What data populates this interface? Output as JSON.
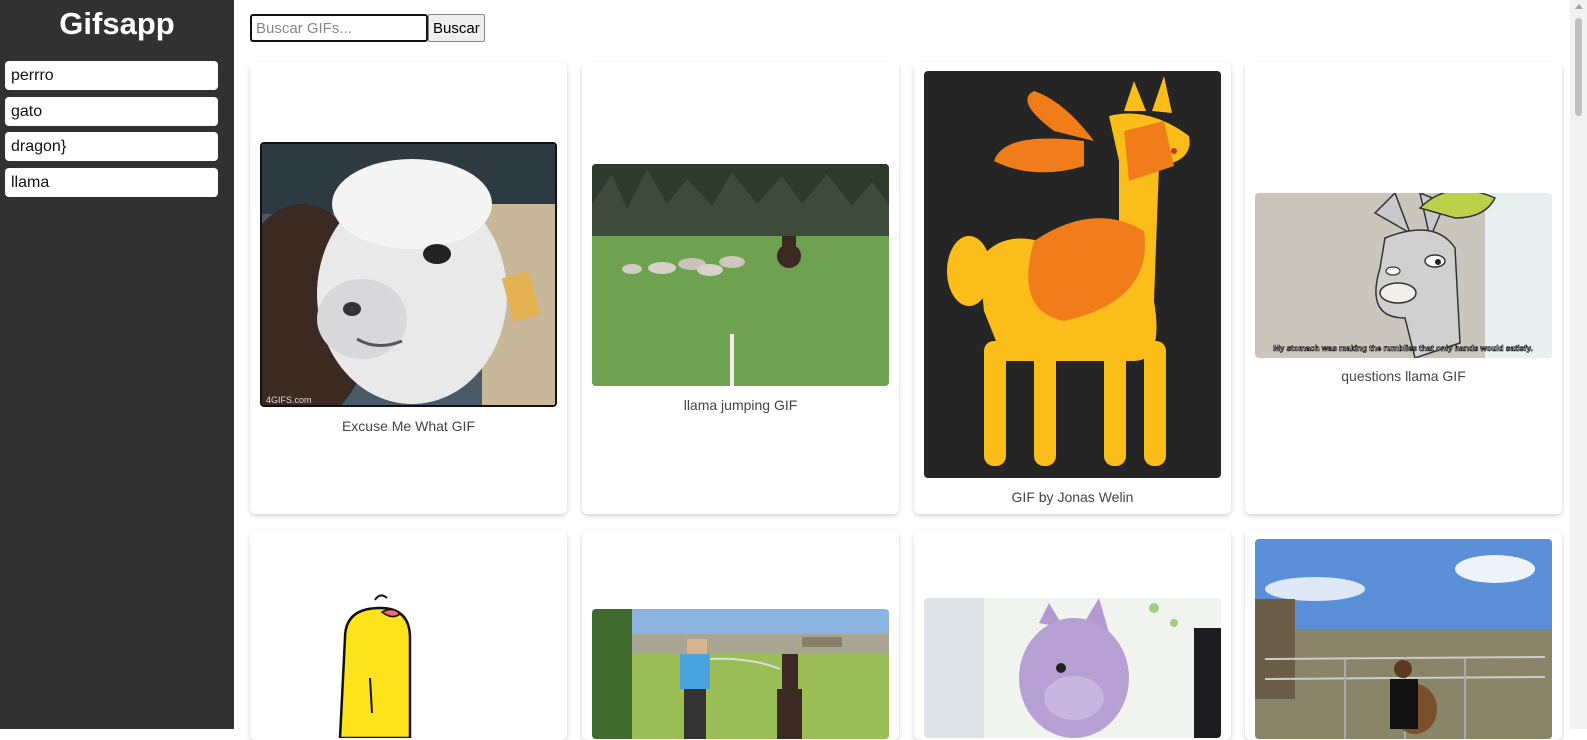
{
  "app": {
    "title": "Gifsapp"
  },
  "history": [
    {
      "label": "perrro"
    },
    {
      "label": "gato"
    },
    {
      "label": "dragon}"
    },
    {
      "label": "llama"
    }
  ],
  "search": {
    "placeholder": "Buscar GIFs...",
    "value": "",
    "button_label": "Buscar"
  },
  "gifs": [
    {
      "title": "Excuse Me What GIF",
      "watermark": "4GIFS.com"
    },
    {
      "title": "llama jumping GIF"
    },
    {
      "title": "GIF by Jonas Welin"
    },
    {
      "title": "questions llama GIF",
      "subtitle": "My stomach was making the rumblies that only hands would satisfy."
    },
    {
      "title": ""
    },
    {
      "title": ""
    },
    {
      "title": ""
    },
    {
      "title": ""
    }
  ],
  "colors": {
    "sidebar_bg": "#313131",
    "page_bg": "#ffffff",
    "accent_yellow": "#fbbd1a"
  }
}
